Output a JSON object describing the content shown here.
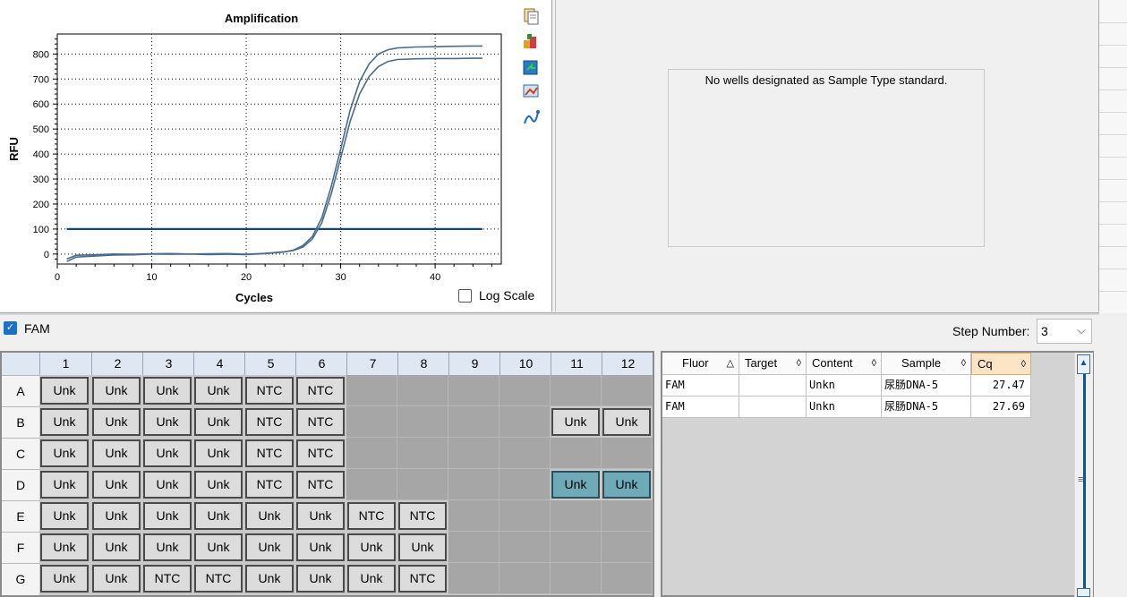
{
  "chart_data": {
    "type": "line",
    "title": "Amplification",
    "xlabel": "Cycles",
    "ylabel": "RFU",
    "xlim": [
      0,
      47
    ],
    "ylim": [
      -40,
      880
    ],
    "x_ticks": [
      0,
      10,
      20,
      30,
      40
    ],
    "y_ticks": [
      0,
      100,
      200,
      300,
      400,
      500,
      600,
      700,
      800
    ],
    "grid": true,
    "threshold": 100,
    "series": [
      {
        "x": [
          1,
          2,
          4,
          6,
          8,
          10,
          12,
          14,
          16,
          18,
          20,
          22,
          24,
          25,
          26,
          27,
          28,
          29,
          30,
          31,
          32,
          33,
          34,
          35,
          36,
          38,
          40,
          42,
          44,
          45
        ],
        "values": [
          -30,
          -12,
          -8,
          -4,
          -3,
          0,
          -1,
          0,
          -2,
          -1,
          -2,
          2,
          8,
          16,
          34,
          70,
          145,
          270,
          420,
          575,
          690,
          760,
          800,
          817,
          824,
          828,
          829,
          831,
          832,
          832
        ]
      },
      {
        "x": [
          1,
          2,
          4,
          6,
          8,
          10,
          12,
          14,
          16,
          18,
          20,
          22,
          24,
          25,
          26,
          27,
          28,
          29,
          30,
          31,
          32,
          33,
          34,
          35,
          36,
          38,
          40,
          42,
          44,
          45
        ],
        "values": [
          -20,
          -5,
          -3,
          0,
          -1,
          1,
          2,
          0,
          1,
          2,
          -1,
          3,
          9,
          14,
          28,
          60,
          125,
          240,
          385,
          530,
          640,
          710,
          750,
          770,
          778,
          781,
          782,
          782,
          783,
          783
        ]
      }
    ],
    "colors": {
      "line": "#4a6c8c",
      "threshold": "#16457a"
    }
  },
  "chart_toolbar": [
    "copy-icon",
    "export-icon",
    "refresh-icon",
    "image-icon",
    "chart-style-icon"
  ],
  "log_scale": {
    "label": "Log Scale",
    "checked": false
  },
  "std_curve": {
    "message": "No wells designated as Sample Type standard."
  },
  "fluor": {
    "label": "FAM",
    "checked": true
  },
  "step": {
    "label": "Step Number:",
    "value": "3"
  },
  "plate": {
    "columns": [
      "1",
      "2",
      "3",
      "4",
      "5",
      "6",
      "7",
      "8",
      "9",
      "10",
      "11",
      "12"
    ],
    "rows": [
      {
        "label": "A",
        "cells": [
          "Unk",
          "Unk",
          "Unk",
          "Unk",
          "NTC",
          "NTC",
          "",
          "",
          "",
          "",
          "",
          ""
        ]
      },
      {
        "label": "B",
        "cells": [
          "Unk",
          "Unk",
          "Unk",
          "Unk",
          "NTC",
          "NTC",
          "",
          "",
          "",
          "",
          "Unk",
          "Unk"
        ]
      },
      {
        "label": "C",
        "cells": [
          "Unk",
          "Unk",
          "Unk",
          "Unk",
          "NTC",
          "NTC",
          "",
          "",
          "",
          "",
          "",
          ""
        ]
      },
      {
        "label": "D",
        "cells": [
          "Unk",
          "Unk",
          "Unk",
          "Unk",
          "NTC",
          "NTC",
          "",
          "",
          "",
          "",
          "Unk",
          "Unk"
        ]
      },
      {
        "label": "E",
        "cells": [
          "Unk",
          "Unk",
          "Unk",
          "Unk",
          "Unk",
          "Unk",
          "NTC",
          "NTC",
          "",
          "",
          "",
          ""
        ]
      },
      {
        "label": "F",
        "cells": [
          "Unk",
          "Unk",
          "Unk",
          "Unk",
          "Unk",
          "Unk",
          "Unk",
          "Unk",
          "",
          "",
          "",
          ""
        ]
      },
      {
        "label": "G",
        "cells": [
          "Unk",
          "Unk",
          "NTC",
          "NTC",
          "Unk",
          "Unk",
          "Unk",
          "NTC",
          "",
          "",
          "",
          ""
        ]
      }
    ],
    "selected": [
      [
        3,
        10
      ],
      [
        3,
        11
      ]
    ]
  },
  "results": {
    "headers": [
      {
        "label": "Fluor",
        "sort": "△"
      },
      {
        "label": "Target",
        "sort": "◊"
      },
      {
        "label": "Content",
        "sort": "◊"
      },
      {
        "label": "Sample",
        "sort": "◊"
      },
      {
        "label": "Cq",
        "sort": "◊"
      }
    ],
    "rows": [
      [
        "FAM",
        "",
        "Unkn",
        "尿肠DNA-5",
        "27.47"
      ],
      [
        "FAM",
        "",
        "Unkn",
        "尿肠DNA-5",
        "27.69"
      ]
    ]
  }
}
